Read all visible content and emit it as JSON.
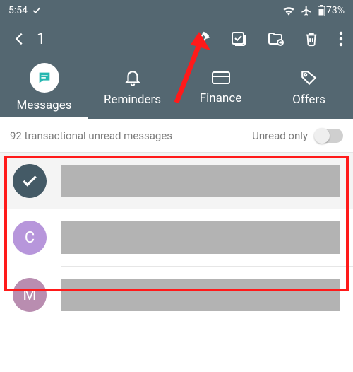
{
  "status": {
    "time": "5:54",
    "battery": "73%"
  },
  "appbar": {
    "selected_count": "1"
  },
  "tabs": {
    "messages": "Messages",
    "reminders": "Reminders",
    "finance": "Finance",
    "offers": "Offers"
  },
  "filter": {
    "summary": "92  transactional unread messages",
    "unread_label": "Unread only"
  },
  "rows": [
    {
      "avatar_letter": "",
      "selected": true
    },
    {
      "avatar_letter": "C",
      "selected": false
    },
    {
      "avatar_letter": "M",
      "selected": false
    }
  ]
}
